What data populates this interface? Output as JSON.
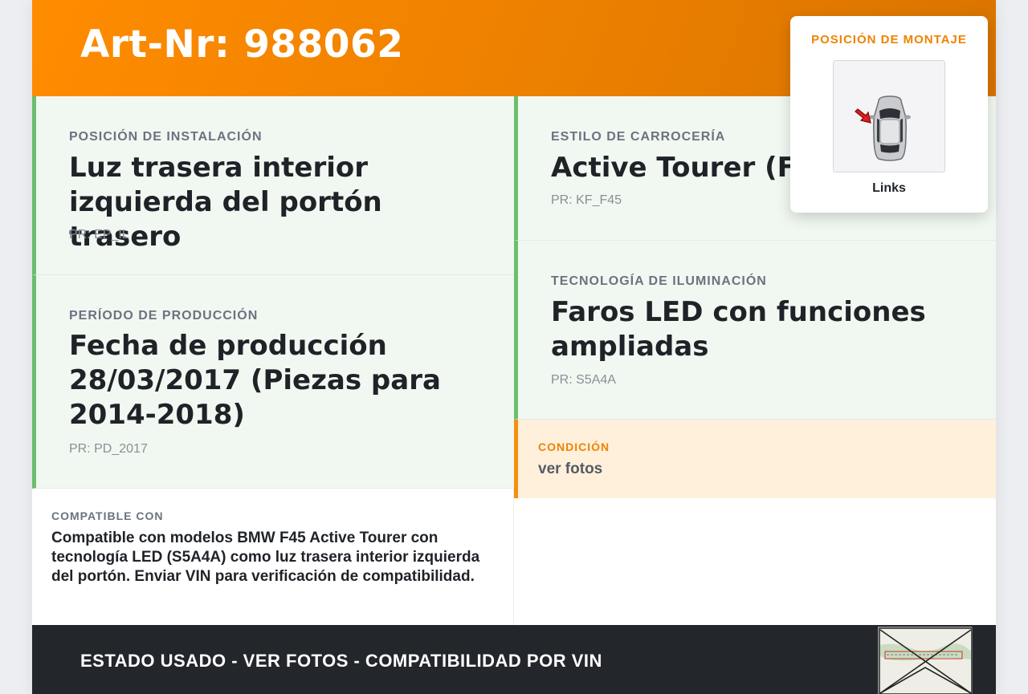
{
  "header": {
    "title": "Art-Nr: 988062"
  },
  "installation_position": {
    "label": "POSICIÓN DE INSTALACIÓN",
    "value": "Luz trasera interior izquierda del portón trasero",
    "code": "PR: EP_IL"
  },
  "production_period": {
    "label": "PERÍODO DE PRODUCCIÓN",
    "value": "Fecha de producción 28/03/2017 (Piezas para 2014-2018)",
    "code": "PR: PD_2017"
  },
  "body_style": {
    "label": "ESTILO DE CARROCERÍA",
    "value": "Active Tourer (F45)",
    "code": "PR: KF_F45"
  },
  "lighting_technology": {
    "label": "TECNOLOGÍA DE ILUMINACIÓN",
    "value": "Faros LED con funciones ampliadas",
    "code": "PR: S5A4A"
  },
  "condition": {
    "label": "CONDICIÓN",
    "value": "ver fotos",
    "accent_color": "#f08200"
  },
  "compatible_with": {
    "label": "COMPATIBLE CON",
    "value": "Compatible con modelos BMW F45 Active Tourer con tecnología LED (S5A4A) como luz trasera interior izquierda del portón. Enviar VIN para verificación de compatibilidad."
  },
  "mounting_position": {
    "title": "POSICIÓN DE MONTAJE",
    "caption": "Links",
    "icon": "car-top-view-with-red-arrow"
  },
  "footer": {
    "text": "ESTADO USADO - VER FOTOS - COMPATIBILIDAD POR VIN",
    "thumbnail_icon": "label-photo-thumbnail"
  },
  "colors": {
    "brand_orange": "#ff8c00",
    "section_green": "#6bbf6e",
    "footer_dark": "#23262b"
  }
}
